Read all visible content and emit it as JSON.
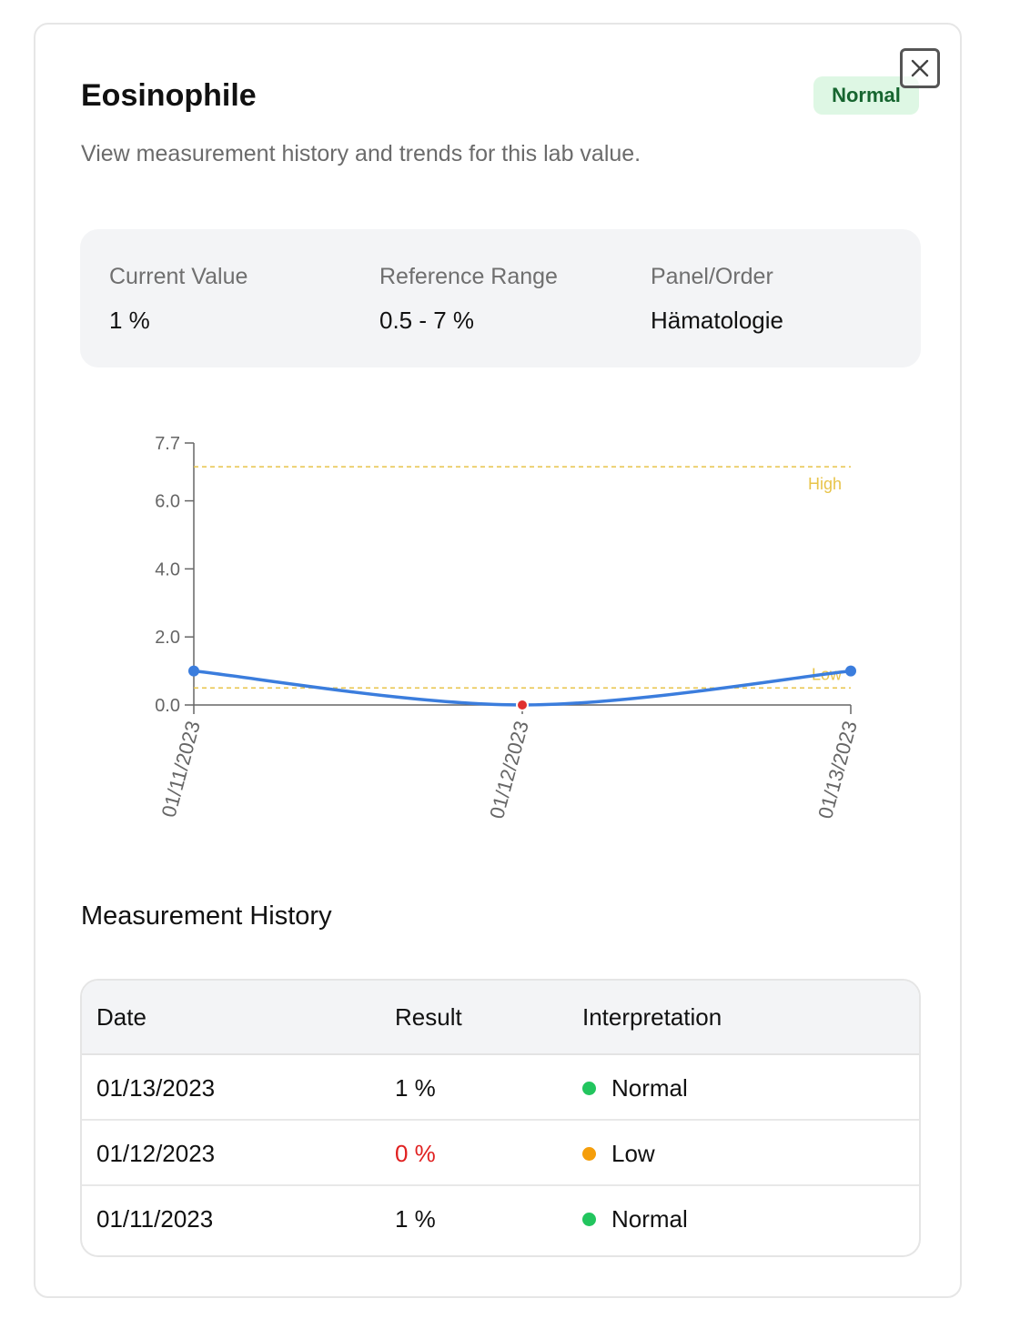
{
  "header": {
    "title": "Eosinophile",
    "status_badge": "Normal",
    "subtitle": "View measurement history and trends for this lab value."
  },
  "summary": {
    "current_label": "Current Value",
    "current_value": "1 %",
    "range_label": "Reference Range",
    "range_value": "0.5 - 7 %",
    "panel_label": "Panel/Order",
    "panel_value": "Hämatologie"
  },
  "chart_data": {
    "type": "line",
    "x": [
      "01/11/2023",
      "01/12/2023",
      "01/13/2023"
    ],
    "values": [
      1,
      0,
      1
    ],
    "point_status": [
      "normal",
      "low",
      "normal"
    ],
    "ylim": [
      0,
      7.7
    ],
    "yticks": [
      0.0,
      2.0,
      4.0,
      6.0,
      7.7
    ],
    "ytick_labels": [
      "0.0",
      "2.0",
      "4.0",
      "6.0",
      "7.7"
    ],
    "reference_lines": [
      {
        "label": "High",
        "value": 7.0
      },
      {
        "label": "Low",
        "value": 0.5
      }
    ],
    "grid": false,
    "colors": {
      "line": "#3b7ddd",
      "low_point": "#e03030",
      "reference": "#e8c44a",
      "axis": "#666666"
    }
  },
  "history": {
    "title": "Measurement History",
    "columns": [
      "Date",
      "Result",
      "Interpretation"
    ],
    "rows": [
      {
        "date": "01/13/2023",
        "result": "1 %",
        "interpretation": "Normal",
        "status": "normal"
      },
      {
        "date": "01/12/2023",
        "result": "0 %",
        "interpretation": "Low",
        "status": "low"
      },
      {
        "date": "01/11/2023",
        "result": "1 %",
        "interpretation": "Normal",
        "status": "normal"
      }
    ]
  },
  "colors": {
    "normal": "#22c55e",
    "low": "#f59e0b",
    "result_low": "#e02020",
    "badge_bg": "#def7e4",
    "badge_text": "#16652f"
  }
}
